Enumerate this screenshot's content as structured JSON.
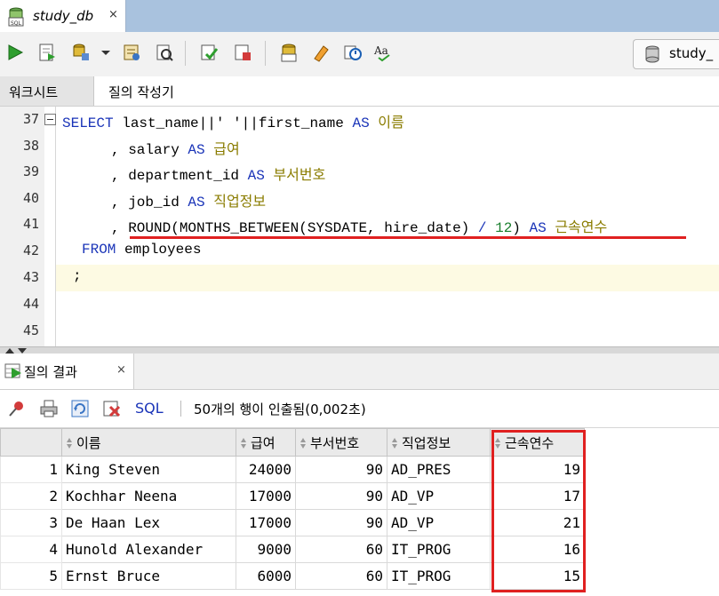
{
  "doc_tab": {
    "title": "study_db",
    "close": "×"
  },
  "toolbar": {
    "icons": [
      "run-statement-icon",
      "run-script-icon",
      "autotrace-icon",
      "dropdown-icon",
      "explain-plan-icon",
      "sql-tuning-icon",
      "commit-icon",
      "rollback-icon",
      "unshared-sql-icon",
      "clear-icon",
      "history-icon",
      "format-icon"
    ],
    "connection_label": "study_"
  },
  "subtabs": {
    "worksheet": "워크시트",
    "query_builder": "질의 작성기"
  },
  "editor": {
    "line_numbers": [
      "37",
      "38",
      "39",
      "40",
      "41",
      "42",
      "43",
      "44",
      "45"
    ],
    "lines": {
      "l37": {
        "kw1": "SELECT",
        "t1": "last_name||' '||first_name",
        "kw2": "AS",
        "alias": "이름"
      },
      "l38": {
        "t1": ", salary",
        "kw": "AS",
        "alias": "급여"
      },
      "l39": {
        "t1": ", department_id",
        "kw": "AS",
        "alias": "부서번호"
      },
      "l40": {
        "t1": ", job_id",
        "kw": "AS",
        "alias": "직업정보"
      },
      "l41": {
        "t1": ", ROUND(MONTHS_BETWEEN(SYSDATE, hire_date)",
        "op": "/",
        "num": "12",
        "t2": ")",
        "kw": "AS",
        "alias": "근속연수"
      },
      "l42": {
        "kw": "FROM",
        "t1": "employees"
      },
      "l43": {
        "t1": ";"
      }
    }
  },
  "results": {
    "tab_label": "질의 결과",
    "tab_close": "×",
    "sql_label": "SQL",
    "message": "50개의 행이 인출됨(0,002초)",
    "columns": [
      "이름",
      "급여",
      "부서번호",
      "직업정보",
      "근속연수"
    ],
    "rows": [
      {
        "n": "1",
        "name": "King Steven",
        "salary": "24000",
        "dept": "90",
        "job": "AD_PRES",
        "years": "19"
      },
      {
        "n": "2",
        "name": "Kochhar Neena",
        "salary": "17000",
        "dept": "90",
        "job": "AD_VP",
        "years": "17"
      },
      {
        "n": "3",
        "name": "De Haan Lex",
        "salary": "17000",
        "dept": "90",
        "job": "AD_VP",
        "years": "21"
      },
      {
        "n": "4",
        "name": "Hunold Alexander",
        "salary": "9000",
        "dept": "60",
        "job": "IT_PROG",
        "years": "16"
      },
      {
        "n": "5",
        "name": "Ernst Bruce",
        "salary": "6000",
        "dept": "60",
        "job": "IT_PROG",
        "years": "15"
      }
    ]
  },
  "colors": {
    "keyword": "#1a34b8",
    "alias": "#8a7c00",
    "number": "#1a7f2e",
    "highlight": "#e02020"
  }
}
